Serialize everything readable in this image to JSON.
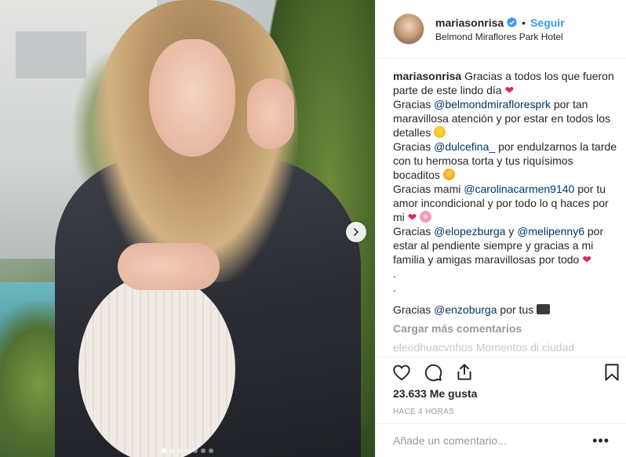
{
  "header": {
    "username": "mariasonrisa",
    "separator": "•",
    "follow_label": "Seguir",
    "location": "Belmond Miraflores Park Hotel"
  },
  "caption": {
    "username": "mariasonrisa",
    "l1": "Gracias a todos los que fueron parte de este lindo día",
    "l2a": "Gracias",
    "m1": "@belmondmirafloresprk",
    "l2b": "por tan maravillosa atención y por estar en todos los detalles",
    "l3a": "Gracias",
    "m2": "@dulcefina_",
    "l3b": "por endulzarnos la tarde con tu hermosa torta y tus riquísimos bocaditos",
    "l4a": "Gracias mami",
    "m3": "@carolinacarmen9140",
    "l4b": "por tu amor incondicional y por todo lo q haces por mi",
    "l5a": "Gracias",
    "m4": "@elopezburga",
    "l5b": "y",
    "m5": "@melipenny6",
    "l5c": "por estar al pendiente siempre y gracias a mi familia y amigas maravillosas por todo",
    "dot1": ".",
    "dot2": ".",
    "l6a": "Gracias",
    "m6": "@enzoburga",
    "l6b": "por tus"
  },
  "load_more": "Cargar más comentarios",
  "partial_comment": "eleodhuacvnhos Momentos di ciudad",
  "likes": "23.633 Me gusta",
  "timestamp": "HACE 4 HORAS",
  "comment_placeholder": "Añade un comentario...",
  "more_label": "•••",
  "heart_glyph": "❤",
  "icons": [
    "verified-badge-icon",
    "like-heart-icon",
    "comment-icon",
    "share-icon",
    "bookmark-icon",
    "next-arrow-icon"
  ],
  "carousel": {
    "count": 7,
    "active_index": 0
  },
  "colors": {
    "accent": "#3897f0",
    "mention": "#003569",
    "heart": "#e0245e",
    "muted": "#999999"
  }
}
